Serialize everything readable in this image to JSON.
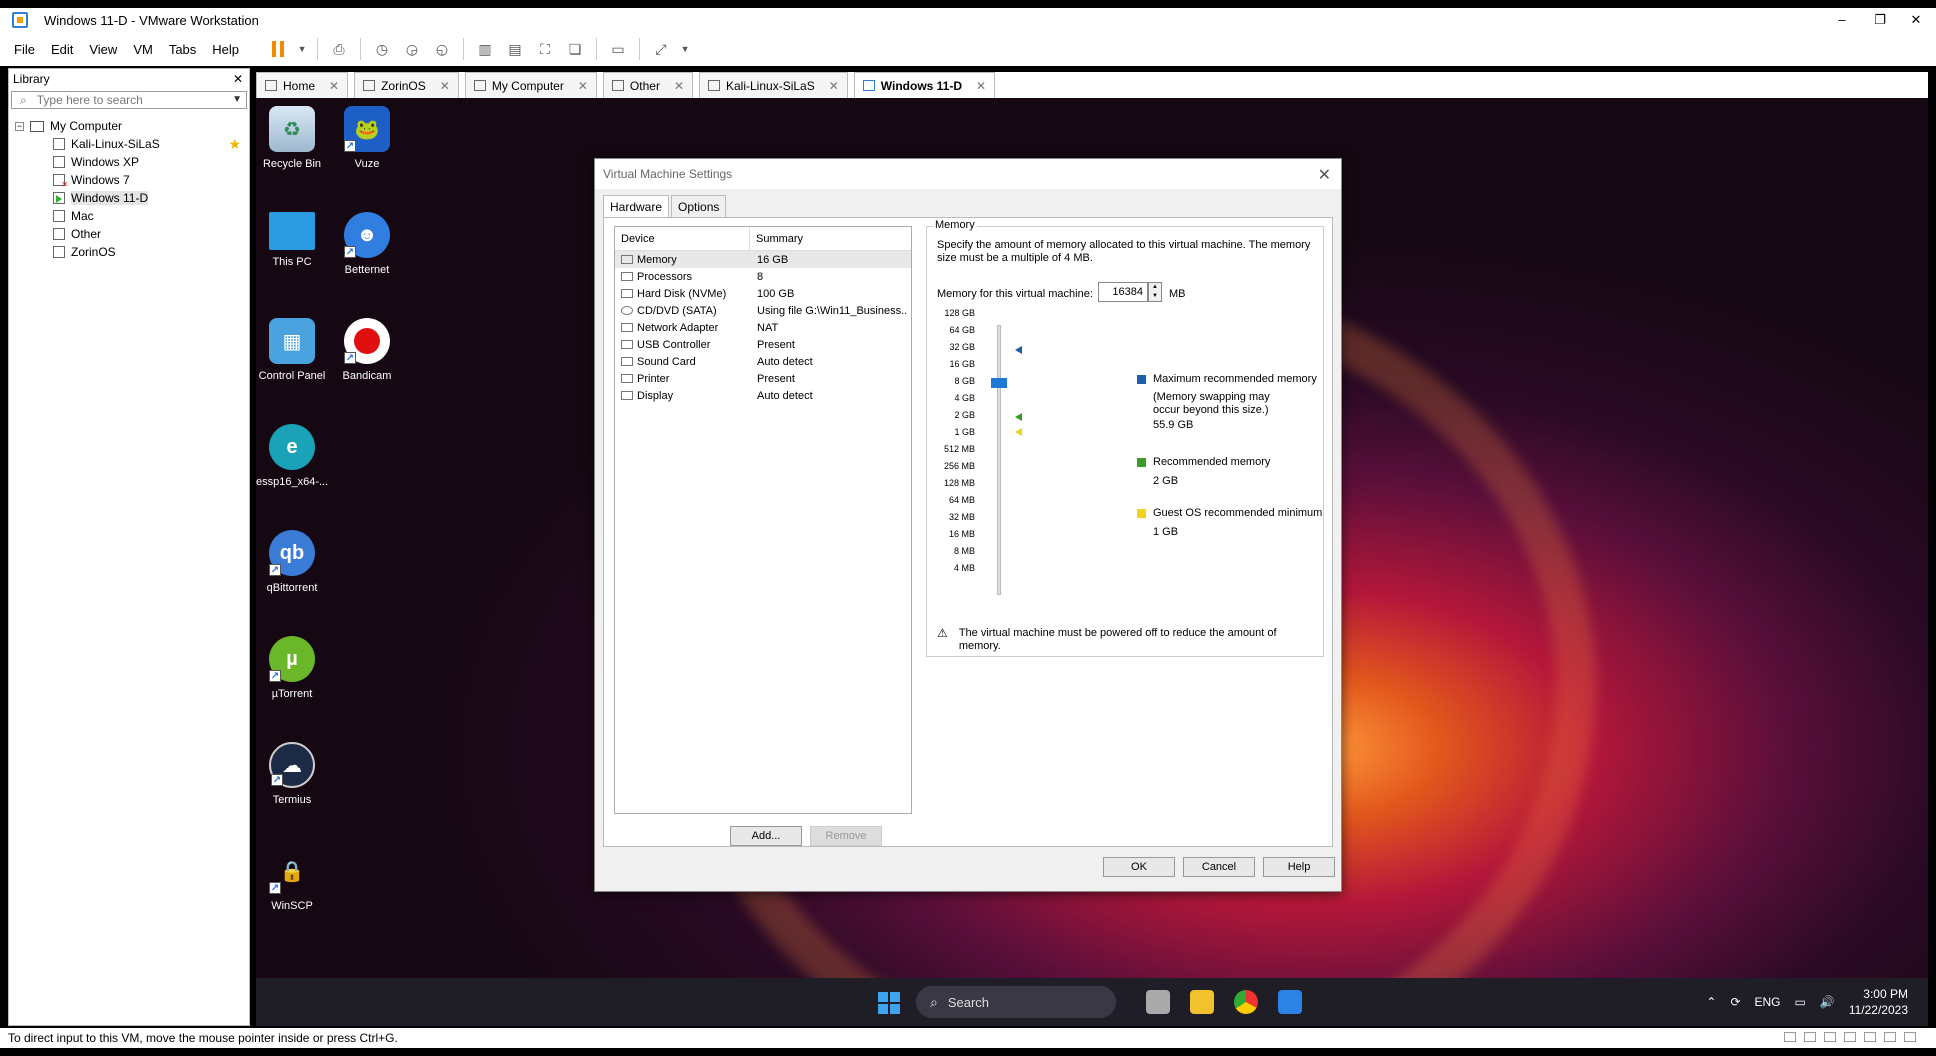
{
  "window": {
    "title": "Windows 11-D - VMware Workstation"
  },
  "menu": [
    "File",
    "Edit",
    "View",
    "VM",
    "Tabs",
    "Help"
  ],
  "library": {
    "title": "Library",
    "search_placeholder": "Type here to search",
    "root": "My Computer",
    "items": [
      "Kali-Linux-SiLaS",
      "Windows XP",
      "Windows 7",
      "Windows 11-D",
      "Mac",
      "Other",
      "ZorinOS"
    ]
  },
  "tabs": [
    "Home",
    "ZorinOS",
    "My Computer",
    "Other",
    "Kali-Linux-SiLaS",
    "Windows 11-D"
  ],
  "desktop": {
    "icons": [
      "Recycle Bin",
      "Vuze",
      "This PC",
      "Betternet",
      "Control Panel",
      "Bandicam",
      "essp16_x64-...",
      "qBittorrent",
      "µTorrent",
      "Termius",
      "WinSCP"
    ]
  },
  "taskbar": {
    "search": "Search",
    "lang": "ENG",
    "time": "3:00 PM",
    "date": "11/22/2023"
  },
  "statusbar": {
    "text": "To direct input to this VM, move the mouse pointer inside or press Ctrl+G."
  },
  "dialog": {
    "title": "Virtual Machine Settings",
    "tabs": [
      "Hardware",
      "Options"
    ],
    "device_header": {
      "device": "Device",
      "summary": "Summary"
    },
    "devices": [
      {
        "name": "Memory",
        "summary": "16 GB"
      },
      {
        "name": "Processors",
        "summary": "8"
      },
      {
        "name": "Hard Disk (NVMe)",
        "summary": "100 GB"
      },
      {
        "name": "CD/DVD (SATA)",
        "summary": "Using file G:\\Win11_Business..."
      },
      {
        "name": "Network Adapter",
        "summary": "NAT"
      },
      {
        "name": "USB Controller",
        "summary": "Present"
      },
      {
        "name": "Sound Card",
        "summary": "Auto detect"
      },
      {
        "name": "Printer",
        "summary": "Present"
      },
      {
        "name": "Display",
        "summary": "Auto detect"
      }
    ],
    "add_label": "Add...",
    "remove_label": "Remove",
    "memory": {
      "legend": "Memory",
      "description": "Specify the amount of memory allocated to this virtual machine. The memory size must be a multiple of 4 MB.",
      "field_label": "Memory for this virtual machine:",
      "value": "16384",
      "unit": "MB",
      "scale": [
        "128 GB",
        "64 GB",
        "32 GB",
        "16 GB",
        "8 GB",
        "4 GB",
        "2 GB",
        "1 GB",
        "512 MB",
        "256 MB",
        "128 MB",
        "64 MB",
        "32 MB",
        "16 MB",
        "8 MB",
        "4 MB"
      ],
      "max_title": "Maximum recommended memory",
      "max_note": "(Memory swapping may occur beyond this size.)",
      "max_value": "55.9 GB",
      "rec_title": "Recommended memory",
      "rec_value": "2 GB",
      "min_title": "Guest OS recommended minimum",
      "min_value": "1 GB",
      "warning": "The virtual machine must be powered off to reduce the amount of memory.",
      "colors": {
        "max": "#1f5fa8",
        "rec": "#3a9a2a",
        "min": "#f2d21b"
      }
    },
    "ok_label": "OK",
    "cancel_label": "Cancel",
    "help_label": "Help"
  }
}
